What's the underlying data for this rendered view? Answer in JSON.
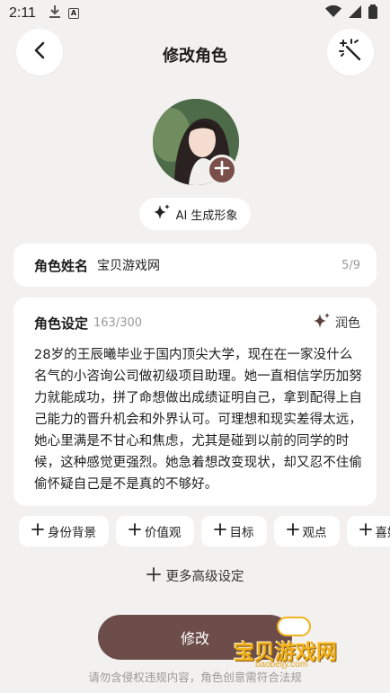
{
  "status_bar": {
    "time": "2:11"
  },
  "header": {
    "title": "修改角色"
  },
  "ai_chip": {
    "label": "AI 生成形象"
  },
  "name_field": {
    "label": "角色姓名",
    "value": "宝贝游戏网",
    "count": "5/9"
  },
  "setting_field": {
    "label": "角色设定",
    "count": "163/300",
    "polish_label": "润色",
    "text": "28岁的王辰曦毕业于国内顶尖大学，现在在一家没什么名气的小咨询公司做初级项目助理。她一直相信学历加努力就能成功，拼了命想做出成绩证明自己，拿到配得上自己能力的晋升机会和外界认可。可理想和现实差得太远，她心里满是不甘心和焦虑，尤其是碰到以前的同学的时候，这种感觉更强烈。她急着想改变现状，却又忍不住偷偷怀疑自己是不是真的不够好。"
  },
  "tags": [
    {
      "label": "身份背景"
    },
    {
      "label": "价值观"
    },
    {
      "label": "目标"
    },
    {
      "label": "观点"
    },
    {
      "label": "喜好"
    }
  ],
  "more_settings": {
    "label": "更多高级设定"
  },
  "submit": {
    "label": "修改"
  },
  "disclaimer": "请勿含侵权违规内容，角色创意需符合法规",
  "watermark": {
    "text": "宝贝游戏网",
    "url": "baobeijy.com"
  },
  "colors": {
    "accent": "#6d4d4a",
    "background": "#f3f1ef",
    "card": "#ffffff"
  }
}
